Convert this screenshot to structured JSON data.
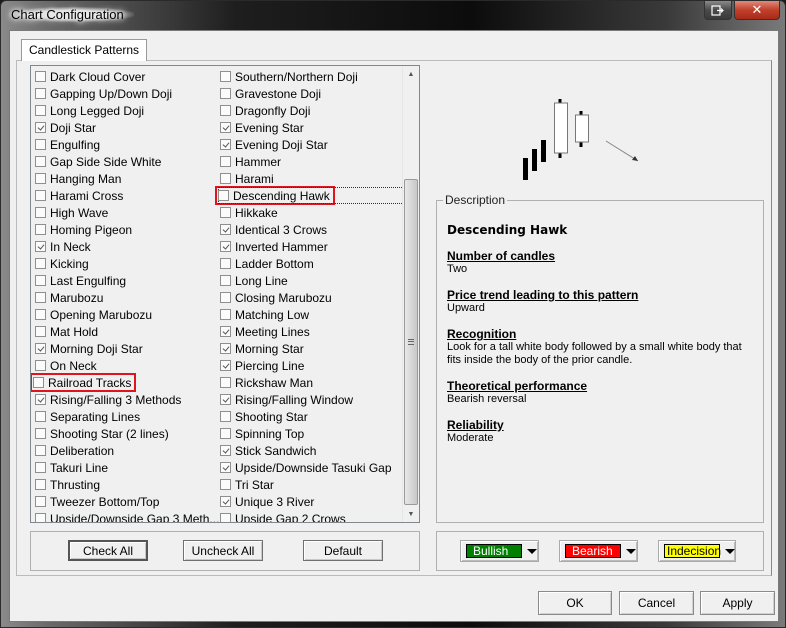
{
  "window": {
    "title": "Chart Configuration"
  },
  "tabs": [
    {
      "label": "Candlestick Patterns",
      "active": true
    }
  ],
  "patterns": {
    "column_a": [
      {
        "label": "Dark Cloud Cover",
        "checked": false
      },
      {
        "label": "Gapping Up/Down Doji",
        "checked": false
      },
      {
        "label": "Long Legged Doji",
        "checked": false
      },
      {
        "label": "Doji Star",
        "checked": true
      },
      {
        "label": "Engulfing",
        "checked": false
      },
      {
        "label": "Gap Side Side White",
        "checked": false
      },
      {
        "label": "Hanging Man",
        "checked": false
      },
      {
        "label": "Harami Cross",
        "checked": false
      },
      {
        "label": "High Wave",
        "checked": false
      },
      {
        "label": "Homing Pigeon",
        "checked": false
      },
      {
        "label": "In Neck",
        "checked": true
      },
      {
        "label": "Kicking",
        "checked": false
      },
      {
        "label": "Last Engulfing",
        "checked": false
      },
      {
        "label": "Marubozu",
        "checked": false
      },
      {
        "label": "Opening Marubozu",
        "checked": false
      },
      {
        "label": "Mat Hold",
        "checked": false
      },
      {
        "label": "Morning Doji Star",
        "checked": true
      },
      {
        "label": "On Neck",
        "checked": false
      },
      {
        "label": "Railroad Tracks",
        "checked": false,
        "highlighted": true
      },
      {
        "label": "Rising/Falling 3 Methods",
        "checked": true
      },
      {
        "label": "Separating Lines",
        "checked": false
      },
      {
        "label": "Shooting Star (2 lines)",
        "checked": false
      },
      {
        "label": "Deliberation",
        "checked": false
      },
      {
        "label": "Takuri Line",
        "checked": false
      },
      {
        "label": "Thrusting",
        "checked": false
      },
      {
        "label": "Tweezer Bottom/Top",
        "checked": false
      },
      {
        "label": "Upside/Downside Gap 3 Meth...",
        "checked": false
      }
    ],
    "column_b": [
      {
        "label": "Southern/Northern Doji",
        "checked": false
      },
      {
        "label": "Gravestone Doji",
        "checked": false
      },
      {
        "label": "Dragonfly Doji",
        "checked": false
      },
      {
        "label": "Evening Star",
        "checked": true
      },
      {
        "label": "Evening Doji Star",
        "checked": true
      },
      {
        "label": "Hammer",
        "checked": false
      },
      {
        "label": "Harami",
        "checked": false
      },
      {
        "label": "Descending Hawk",
        "checked": false,
        "highlighted": true,
        "focused": true
      },
      {
        "label": "Hikkake",
        "checked": false
      },
      {
        "label": "Identical 3 Crows",
        "checked": true
      },
      {
        "label": "Inverted Hammer",
        "checked": true
      },
      {
        "label": "Ladder Bottom",
        "checked": false
      },
      {
        "label": "Long Line",
        "checked": false
      },
      {
        "label": "Closing Marubozu",
        "checked": false
      },
      {
        "label": "Matching Low",
        "checked": false
      },
      {
        "label": "Meeting Lines",
        "checked": true
      },
      {
        "label": "Morning Star",
        "checked": true
      },
      {
        "label": "Piercing Line",
        "checked": true
      },
      {
        "label": "Rickshaw Man",
        "checked": false
      },
      {
        "label": "Rising/Falling Window",
        "checked": true
      },
      {
        "label": "Shooting Star",
        "checked": false
      },
      {
        "label": "Spinning Top",
        "checked": false
      },
      {
        "label": "Stick Sandwich",
        "checked": true
      },
      {
        "label": "Upside/Downside Tasuki Gap",
        "checked": true
      },
      {
        "label": "Tri Star",
        "checked": false
      },
      {
        "label": "Unique 3 River",
        "checked": true
      },
      {
        "label": "Upside Gap 2 Crows",
        "checked": false
      }
    ]
  },
  "list_buttons": {
    "check_all": "Check All",
    "uncheck_all": "Uncheck All",
    "default": "Default"
  },
  "description": {
    "legend": "Description",
    "title": "Descending Hawk",
    "sections": [
      {
        "heading": "Number of candles",
        "value": "Two"
      },
      {
        "heading": "Price trend leading to this pattern",
        "value": "Upward"
      },
      {
        "heading": "Recognition",
        "value": "Look for a tall white body followed by a small white body that fits inside the body of the prior candle."
      },
      {
        "heading": "Theoretical performance",
        "value": "Bearish reversal"
      },
      {
        "heading": "Reliability",
        "value": "Moderate"
      }
    ]
  },
  "color_pickers": [
    {
      "label": "Bullish",
      "color": "#008000",
      "text_color": "#ffffff"
    },
    {
      "label": "Bearish",
      "color": "#ff0000",
      "text_color": "#ffffff"
    },
    {
      "label": "Indecision",
      "color": "#ffff00",
      "text_color": "#000000"
    }
  ],
  "footer": {
    "ok": "OK",
    "cancel": "Cancel",
    "apply": "Apply"
  },
  "icons": {
    "restore": "restore-window-icon",
    "close": "close-icon",
    "scroll_up": "scroll-up-arrow-icon",
    "scroll_down": "scroll-down-arrow-icon",
    "dropdown": "chevron-down-icon"
  }
}
